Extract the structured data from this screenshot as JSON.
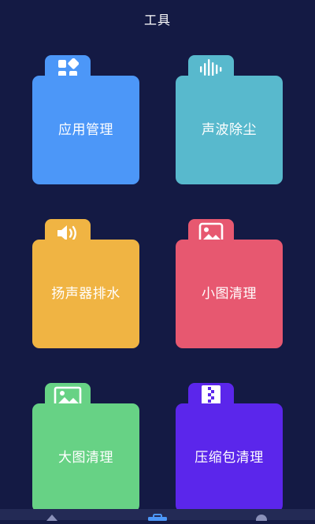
{
  "header": {
    "title": "工具"
  },
  "tiles": [
    {
      "label": "应用管理",
      "icon": "apps-grid-icon",
      "color": "#4c97f8"
    },
    {
      "label": "声波除尘",
      "icon": "sound-wave-icon",
      "color": "#58b9cd"
    },
    {
      "label": "扬声器排水",
      "icon": "speaker-icon",
      "color": "#f0b443"
    },
    {
      "label": "小图清理",
      "icon": "image-icon",
      "color": "#e75870"
    },
    {
      "label": "大图清理",
      "icon": "image-icon",
      "color": "#67d285"
    },
    {
      "label": "压缩包清理",
      "icon": "zip-file-icon",
      "color": "#5b26eb"
    }
  ],
  "bottom_nav": {
    "items": [
      {
        "icon": "home-icon",
        "active": false
      },
      {
        "icon": "toolbox-icon",
        "active": true
      },
      {
        "icon": "profile-icon",
        "active": false
      }
    ],
    "active_color": "#4c97f8",
    "inactive_color": "#8a90b8"
  }
}
